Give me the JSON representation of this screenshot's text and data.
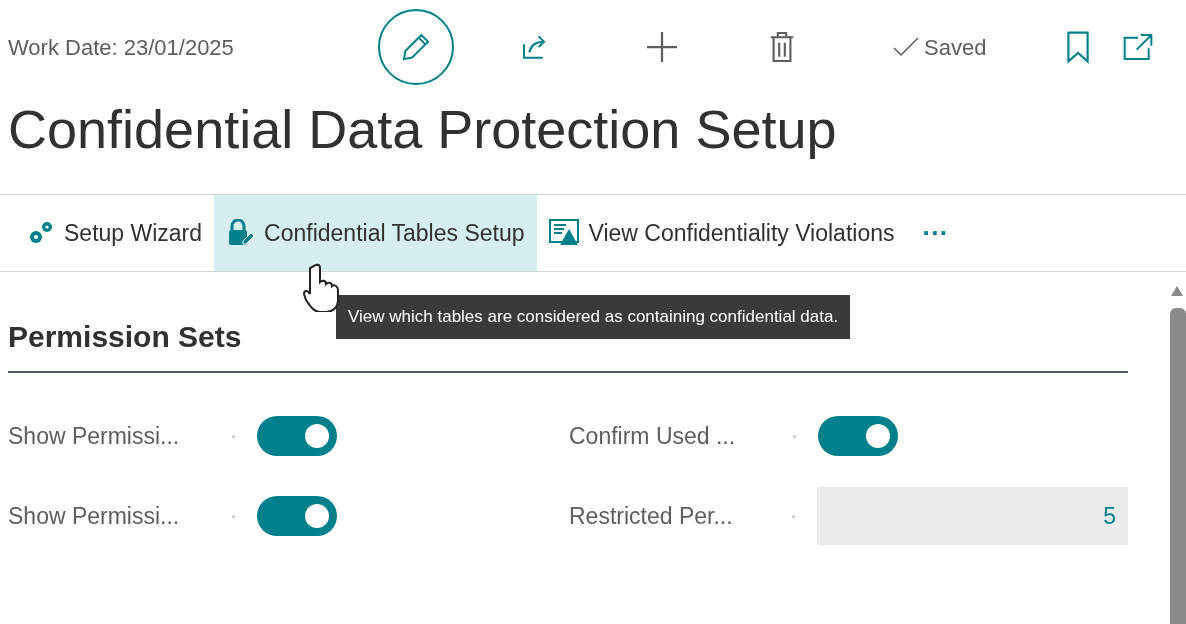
{
  "header": {
    "work_date": "Work Date: 23/01/2025",
    "saved_status": "Saved"
  },
  "title": "Confidential Data Protection Setup",
  "actions": [
    {
      "label": "Setup Wizard",
      "kind": "wizard",
      "highlighted": false
    },
    {
      "label": "Confidential Tables Setup",
      "kind": "lock",
      "highlighted": true
    },
    {
      "label": "View Confidentiality Violations",
      "kind": "report",
      "highlighted": false
    }
  ],
  "more_actions": "···",
  "tooltip": "View which tables are considered as containing confidential data.",
  "section": {
    "title": "Permission Sets",
    "fields": [
      {
        "label": "Show Permissi...",
        "kind": "toggle",
        "on": true
      },
      {
        "label": "Confirm Used ...",
        "kind": "toggle",
        "on": true
      },
      {
        "label": "Show Permissi...",
        "kind": "toggle",
        "on": true
      },
      {
        "label": "Restricted Per...",
        "kind": "number",
        "value": "5"
      }
    ]
  }
}
